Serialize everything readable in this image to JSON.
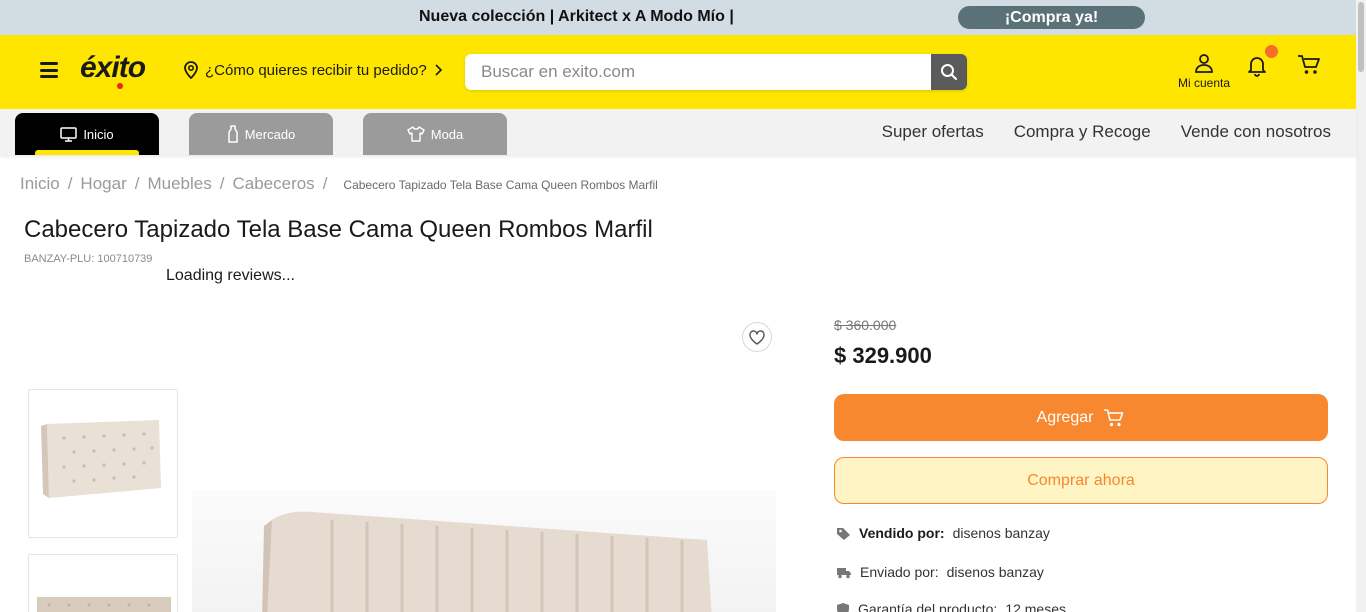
{
  "promo": {
    "text": "Nueva colección | Arkitect x A Modo Mío |",
    "cta": "¡Compra ya!"
  },
  "header": {
    "logo": "éxito",
    "location_prompt": "¿Cómo quieres recibir tu pedido?",
    "search_placeholder": "Buscar en exito.com",
    "account_label": "Mi cuenta",
    "icons": [
      "menu-icon",
      "location-pin-icon",
      "search-icon",
      "user-icon",
      "bell-icon",
      "cart-icon"
    ],
    "brand_color": "#ffe600",
    "notification_color": "#f66f2a"
  },
  "nav": {
    "tabs": [
      {
        "label": "Inicio",
        "icon": "monitor-icon",
        "active": true
      },
      {
        "label": "Mercado",
        "icon": "bottle-icon",
        "active": false
      },
      {
        "label": "Moda",
        "icon": "shirt-icon",
        "active": false
      }
    ],
    "links": [
      "Super ofertas",
      "Compra y Recoge",
      "Vende con nosotros"
    ]
  },
  "breadcrumb": {
    "items": [
      "Inicio",
      "Hogar",
      "Muebles",
      "Cabeceros"
    ],
    "current": "Cabecero Tapizado Tela Base Cama Queen Rombos Marfil"
  },
  "product": {
    "title": "Cabecero Tapizado Tela Base Cama Queen Rombos Marfil",
    "sku": "BANZAY-PLU: 100710739",
    "reviews_status": "Loading reviews...",
    "old_price": "$ 360.000",
    "price": "$ 329.900",
    "add_label": "Agregar",
    "buy_label": "Comprar ahora",
    "accent_color": "#f7882f",
    "sold_by_label": "Vendido por:",
    "sold_by_value": "disenos banzay",
    "shipped_by_label": "Enviado por:",
    "shipped_by_value": "disenos banzay",
    "warranty_label": "Garantía del producto:",
    "warranty_value": "12 meses"
  }
}
